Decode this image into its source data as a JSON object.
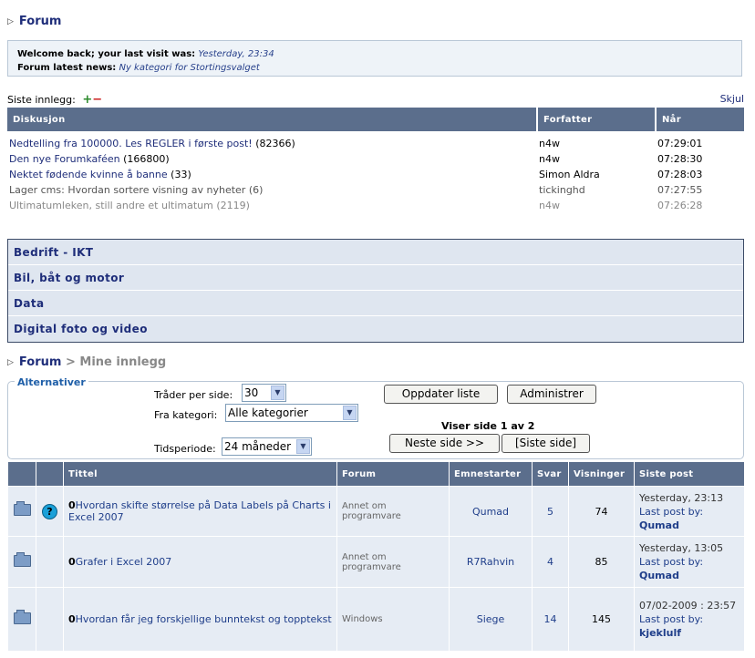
{
  "breadcrumb_top": {
    "label": "Forum"
  },
  "welcome": {
    "line1_label": "Welcome back; your last visit was:",
    "line1_value": "Yesterday, 23:34",
    "line2_label": "Forum latest news:",
    "line2_value": "Ny kategori for Stortingsvalget"
  },
  "latest": {
    "label": "Siste innlegg:",
    "plus": "+",
    "minus": "−",
    "hide": "Skjul",
    "headers": {
      "discussion": "Diskusjon",
      "author": "Forfatter",
      "time": "Når"
    },
    "rows": [
      {
        "title": "Nedtelling fra 100000. Les REGLER i første post!",
        "count": "(82366)",
        "author": "n4w",
        "time": "07:29:01"
      },
      {
        "title": "Den nye Forumkaféen",
        "count": "(166800)",
        "author": "n4w",
        "time": "07:28:30"
      },
      {
        "title": "Nektet fødende kvinne å banne",
        "count": "(33)",
        "author": "Simon Aldra",
        "time": "07:28:03"
      },
      {
        "title": "Lager cms: Hvordan sortere visning av nyheter",
        "count": "(6)",
        "author": "tickinghd",
        "time": "07:27:55"
      },
      {
        "title": "Ultimatumleken, still andre et ultimatum",
        "count": "(2119)",
        "author": "n4w",
        "time": "07:26:28"
      }
    ]
  },
  "categories": [
    "Bedrift - IKT",
    "Bil, båt og motor",
    "Data",
    "Digital foto og video"
  ],
  "breadcrumb2": {
    "forum": "Forum",
    "sep": ">",
    "current": "Mine innlegg"
  },
  "alternatives": {
    "legend": "Alternativer",
    "threads_per_page_label": "Tråder per side:",
    "threads_per_page_value": "30",
    "category_label": "Fra kategori:",
    "category_value": "Alle kategorier",
    "period_label": "Tidsperiode:",
    "period_value": "24 måneder",
    "refresh_button": "Oppdater liste",
    "admin_button": "Administrer",
    "page_info": "Viser side 1 av 2",
    "next_button": "Neste side >>",
    "last_button": "[Siste side]"
  },
  "topics": {
    "headers": {
      "title": "Tittel",
      "forum": "Forum",
      "starter": "Emnestarter",
      "replies": "Svar",
      "views": "Visninger",
      "last": "Siste post"
    },
    "rows": [
      {
        "title": "Hvordan skifte størrelse på Data Labels på Charts i Excel 2007",
        "forum": "Annet om programvare",
        "starter": "Qumad",
        "replies": "5",
        "views": "74",
        "last_time": "Yesterday, 23:13",
        "last_by": "Last post by:",
        "last_user": "Qumad",
        "question": "?"
      },
      {
        "title": "Grafer i Excel 2007",
        "forum": "Annet om programvare",
        "starter": "R7Rahvin",
        "replies": "4",
        "views": "85",
        "last_time": "Yesterday, 13:05",
        "last_by": "Last post by:",
        "last_user": "Qumad",
        "question": ""
      },
      {
        "title": "Hvordan får jeg forskjellige bunntekst og topptekst",
        "forum": "Windows",
        "starter": "Siege",
        "replies": "14",
        "views": "145",
        "last_time": "07/02-2009 : 23:57",
        "last_by": "Last post by:",
        "last_user": "kjeklulf",
        "question": ""
      }
    ]
  },
  "pin_symbol": "0"
}
